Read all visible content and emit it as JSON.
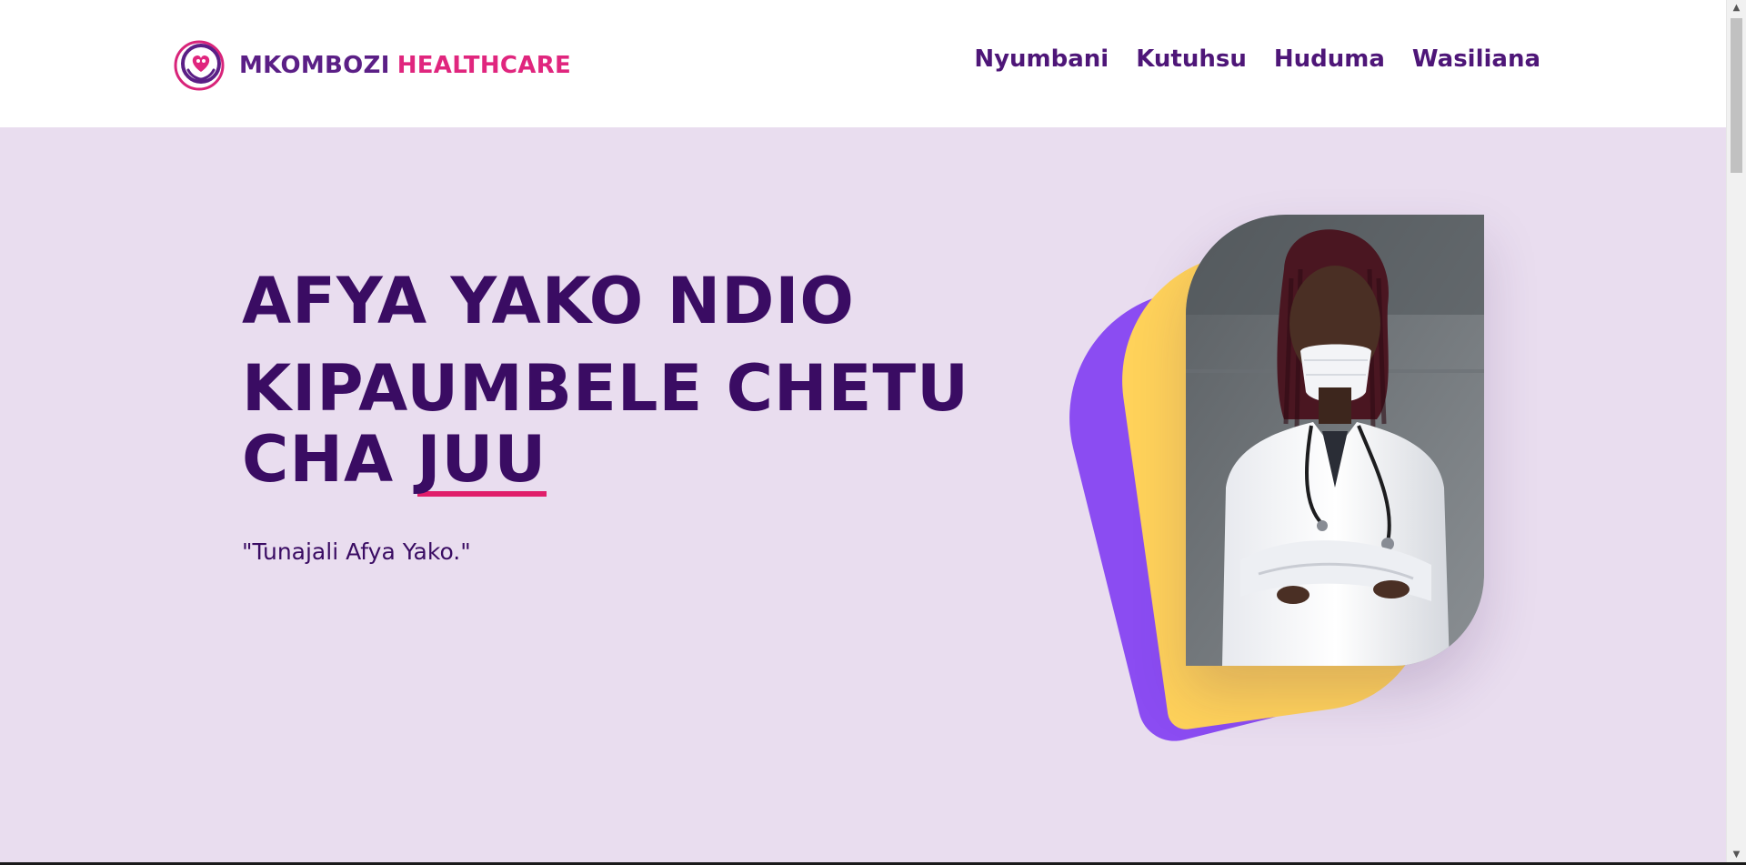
{
  "brand": {
    "name_part1": "MKOMBOZI",
    "name_part2": "HEALTHCARE",
    "logo_icon": "heart-hands-icon"
  },
  "nav": {
    "items": [
      {
        "label": "Nyumbani"
      },
      {
        "label": "Kutuhsu"
      },
      {
        "label": "Huduma"
      },
      {
        "label": "Wasiliana"
      }
    ]
  },
  "hero": {
    "headline_line1": "AFYA YAKO NDIO",
    "headline_line2": "KIPAUMBELE CHETU",
    "headline_line3_prefix": "CHA",
    "headline_accent": "JUU",
    "tagline": "\"Tunajali Afya Yako.\""
  },
  "colors": {
    "primary": "#3a0c63",
    "brand_purple": "#5b1f86",
    "brand_pink": "#e0267e",
    "hero_bg": "#e9ddef",
    "blob_purple": "#8b4cf2",
    "blob_yellow": "#ffd25a"
  }
}
